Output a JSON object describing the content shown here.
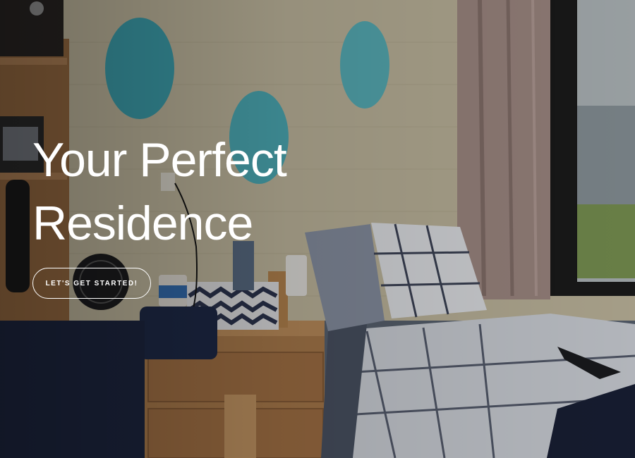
{
  "hero": {
    "title_line1": "Your Perfect",
    "title_line2": "Residence",
    "cta_label": "LET'S GET STARTED!"
  },
  "colors": {
    "wall": "#c9c0a5",
    "polka_dot": "#3fa6b4",
    "wood": "#b07f4e",
    "bedding": "#d9dde4",
    "navy_blanket": "#1e2742",
    "curtain": "#a8918a",
    "window_frame": "#1c1c1c",
    "text": "#ffffff"
  }
}
